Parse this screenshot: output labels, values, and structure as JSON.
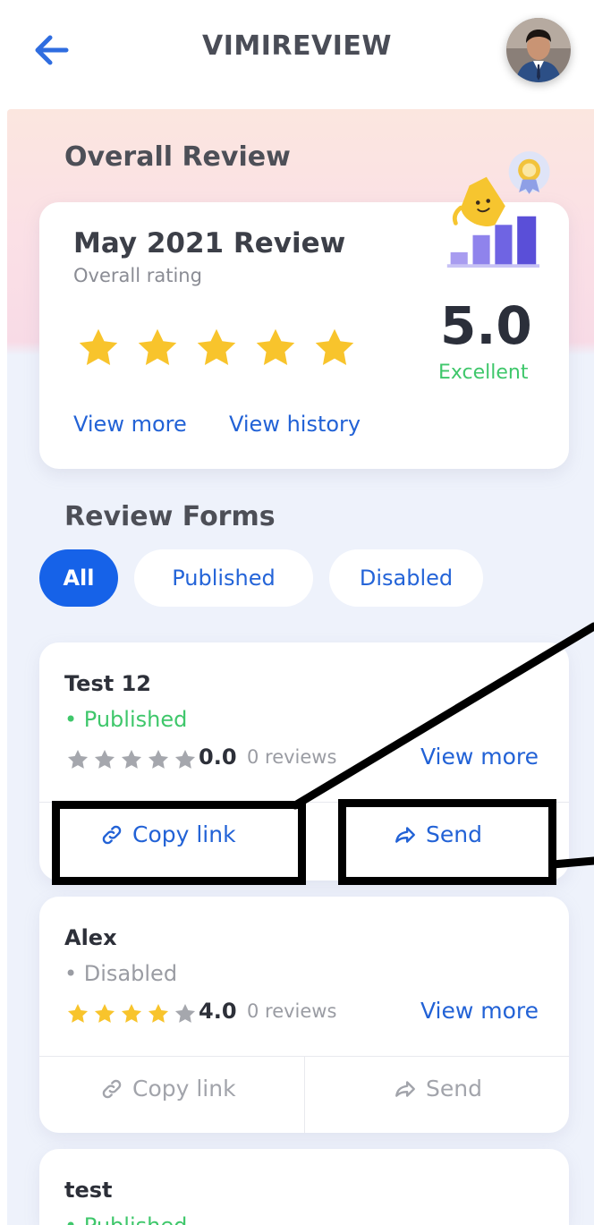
{
  "header": {
    "title": "VIMIREVIEW",
    "back_icon": "arrow-left-icon",
    "avatar_icon": "user-avatar"
  },
  "overall": {
    "section_title": "Overall Review",
    "card_title": "May 2021 Review",
    "card_subtitle": "Overall rating",
    "score": "5.0",
    "rating_label": "Excellent",
    "stars": 5,
    "view_more": "View more",
    "view_history": "View history"
  },
  "forms": {
    "section_title": "Review Forms",
    "tabs": [
      {
        "label": "All",
        "active": true
      },
      {
        "label": "Published",
        "active": false
      },
      {
        "label": "Disabled",
        "active": false
      }
    ],
    "items": [
      {
        "name": "Test 12",
        "status": "• Published",
        "rating": 0,
        "score": "0.0",
        "reviews": "0 reviews",
        "view_more": "View more",
        "copy_link": "Copy link",
        "send": "Send"
      },
      {
        "name": "Alex",
        "status": "• Disabled",
        "rating": 4,
        "score": "4.0",
        "reviews": "0 reviews",
        "view_more": "View more",
        "copy_link": "Copy link",
        "send": "Send"
      },
      {
        "name": "test",
        "status": "• Published"
      }
    ]
  },
  "colors": {
    "accent": "#1662e8",
    "link": "#2262d6",
    "published": "#3fc76b",
    "star_filled": "#f8c42c",
    "star_empty": "#a5a7ad"
  }
}
